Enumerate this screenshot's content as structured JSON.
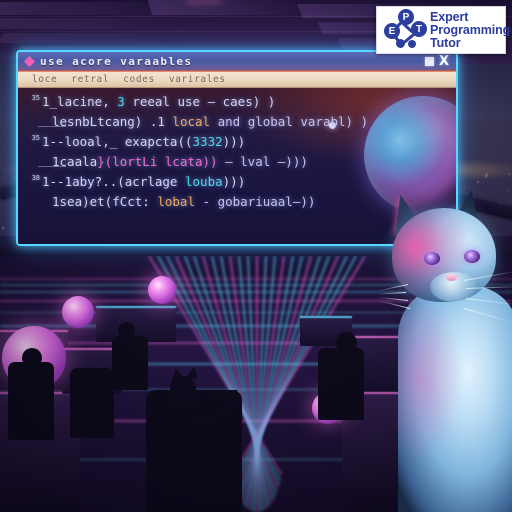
{
  "logo": {
    "nodes": [
      "E",
      "P",
      "T"
    ],
    "line1": "Expert",
    "line2": "Programming",
    "line3": "Tutor"
  },
  "window": {
    "title": "use acore varaables",
    "icon": "diamond-icon",
    "minimize_label": "",
    "close_label": "X",
    "menu": [
      {
        "label": "loce"
      },
      {
        "label": "retral"
      },
      {
        "label": "codes"
      },
      {
        "label": "varirales"
      }
    ],
    "border_color": "#59d8ff"
  },
  "code": {
    "lines": [
      {
        "number": "35",
        "indent": 0,
        "segments": [
          {
            "text": "1_lacine, ",
            "color": "default"
          },
          {
            "text": "3",
            "color": "number"
          },
          {
            "text": " reeal use — caes) )",
            "color": "default"
          }
        ]
      },
      {
        "number": "",
        "indent": 1,
        "segments": [
          {
            "text": "lesnbLtcang) .1 ",
            "color": "default"
          },
          {
            "text": "local",
            "color": "keyword"
          },
          {
            "text": " and global varabl) )",
            "color": "lavender"
          }
        ]
      },
      {
        "number": "35",
        "indent": 0,
        "segments": [
          {
            "text": "1--looal,_ exapcta((",
            "color": "default"
          },
          {
            "text": "3332",
            "color": "number"
          },
          {
            "text": ")))",
            "color": "default"
          }
        ]
      },
      {
        "number": "",
        "indent": 1,
        "segments": [
          {
            "text": "1caala",
            "color": "default"
          },
          {
            "text": "}(lortLi lcata))",
            "color": "pink"
          },
          {
            "text": " — lval —)))",
            "color": "lavender"
          }
        ]
      },
      {
        "number": "38",
        "indent": 0,
        "segments": [
          {
            "text": "1--1aby?..(acrlage ",
            "color": "default"
          },
          {
            "text": "louba",
            "color": "number"
          },
          {
            "text": ")))",
            "color": "default"
          }
        ]
      },
      {
        "number": "",
        "indent": 1,
        "segments": [
          {
            "text": "1sea)et(fCct: ",
            "color": "default"
          },
          {
            "text": "lobal",
            "color": "keyword"
          },
          {
            "text": " - gobariuaal—))",
            "color": "lavender"
          }
        ]
      }
    ],
    "colors": {
      "default": "#d8d2f2",
      "keyword": "#f0a855",
      "number": "#49d8f0",
      "pink": "#f06ad0",
      "lavender": "#c9bff0"
    }
  },
  "scene": {
    "description": "futuristic neon control room at night overlooking a coastal city",
    "foreground_subject": "siamese-cat",
    "secondary_subject": "cat-silhouette-on-chair",
    "planet": "earth-planet-graphic",
    "accent_cyan": "#59d8ff",
    "accent_magenta": "#f06ad0",
    "floor_grid": "neon-grid-floor"
  }
}
